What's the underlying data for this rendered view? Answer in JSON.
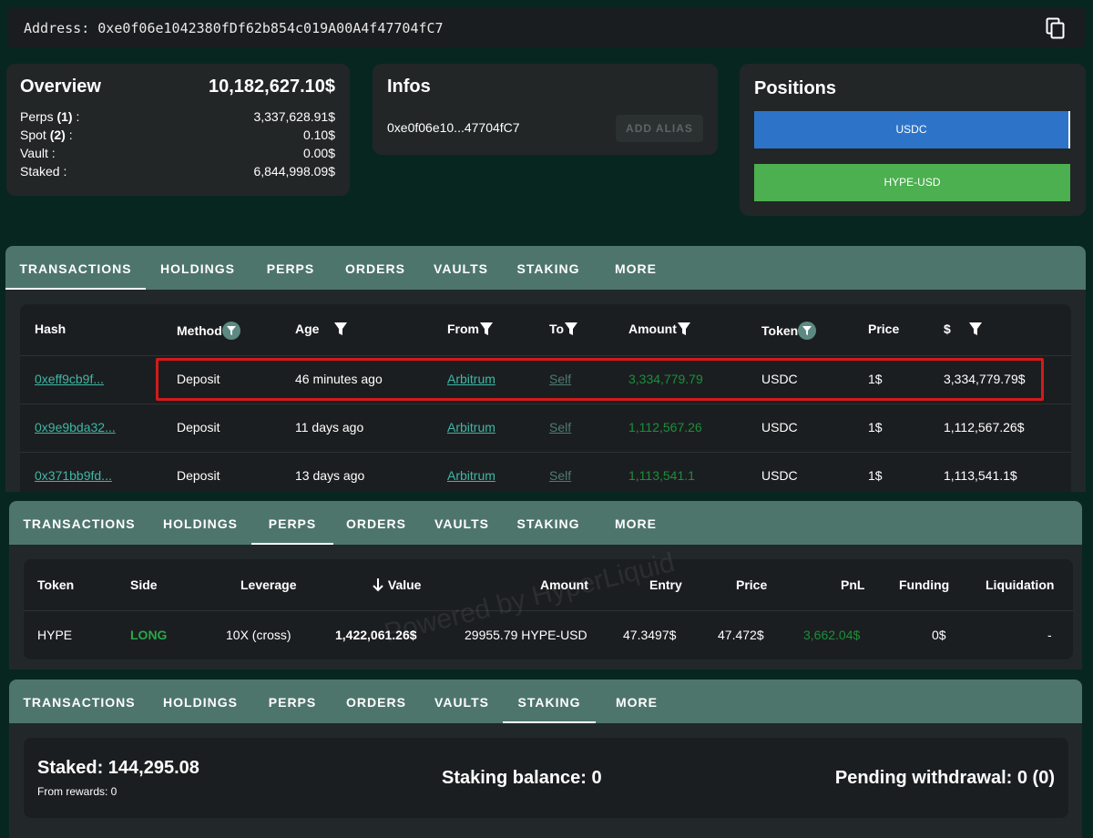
{
  "address_bar": {
    "label": "Address:",
    "address": "0xe0f06e1042380fDf62b854c019A00A4f47704fC7"
  },
  "overview": {
    "title": "Overview",
    "total": "10,182,627.10$",
    "rows": [
      {
        "label": "Perps",
        "count": "(1)",
        "suffix": " :",
        "value": "3,337,628.91$"
      },
      {
        "label": "Spot",
        "count": "(2)",
        "suffix": " :",
        "value": "0.10$"
      },
      {
        "label": "Vault :",
        "count": "",
        "suffix": "",
        "value": "0.00$"
      },
      {
        "label": "Staked :",
        "count": "",
        "suffix": "",
        "value": "6,844,998.09$"
      }
    ]
  },
  "infos": {
    "title": "Infos",
    "short_address": "0xe0f06e10...47704fC7",
    "alias_button": "ADD ALIAS"
  },
  "positions": {
    "title": "Positions",
    "items": [
      "USDC",
      "HYPE-USD"
    ],
    "colors": [
      "#2d74c9",
      "#4caf50"
    ]
  },
  "tabs": [
    "TRANSACTIONS",
    "HOLDINGS",
    "PERPS",
    "ORDERS",
    "VAULTS",
    "STAKING",
    "MORE"
  ],
  "transactions": {
    "headers": [
      "Hash",
      "Method",
      "Age",
      "From",
      "To",
      "Amount",
      "Token",
      "Price",
      "$"
    ],
    "rows": [
      {
        "hash": "0xeff9cb9f...",
        "method": "Deposit",
        "age": "46 minutes ago",
        "from": "Arbitrum",
        "to": "Self",
        "amount": "3,334,779.79",
        "token": "USDC",
        "price": "1$",
        "usd": "3,334,779.79$"
      },
      {
        "hash": "0x9e9bda32...",
        "method": "Deposit",
        "age": "11 days ago",
        "from": "Arbitrum",
        "to": "Self",
        "amount": "1,112,567.26",
        "token": "USDC",
        "price": "1$",
        "usd": "1,112,567.26$"
      },
      {
        "hash": "0x371bb9fd...",
        "method": "Deposit",
        "age": "13 days ago",
        "from": "Arbitrum",
        "to": "Self",
        "amount": "1,113,541.1",
        "token": "USDC",
        "price": "1$",
        "usd": "1,113,541.1$"
      }
    ]
  },
  "perps": {
    "headers": [
      "Token",
      "Side",
      "Leverage",
      "Value",
      "Amount",
      "Entry",
      "Price",
      "PnL",
      "Funding",
      "Liquidation"
    ],
    "rows": [
      {
        "token": "HYPE",
        "side": "LONG",
        "leverage": "10X (cross)",
        "value": "1,422,061.26$",
        "amount": "29955.79 HYPE-USD",
        "entry": "47.3497$",
        "price": "47.472$",
        "pnl": "3,662.04$",
        "funding": "0$",
        "liquidation": "-"
      }
    ],
    "watermark": "Powered by HyperLiquid"
  },
  "staking": {
    "staked": "Staked: 144,295.08",
    "from_rewards": "From rewards: 0",
    "balance": "Staking balance: 0",
    "pending": "Pending withdrawal: 0 (0)"
  }
}
